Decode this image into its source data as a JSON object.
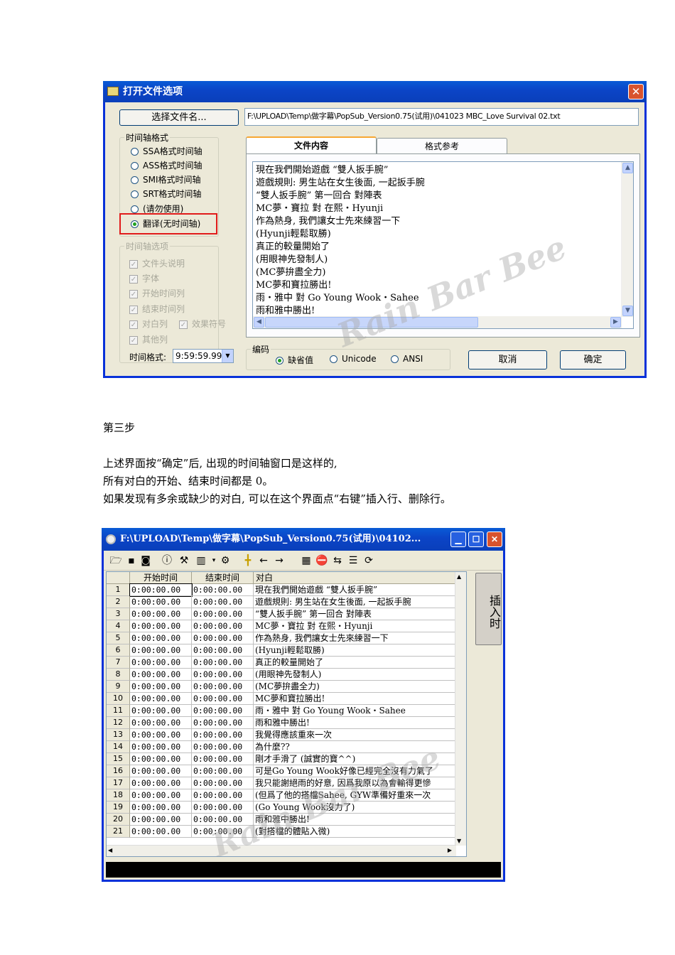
{
  "dialog1": {
    "title": "打开文件选项",
    "choose_file_button": "选择文件名...",
    "file_path": "F:\\UPLOAD\\Temp\\做字幕\\PopSub_Version0.75(试用)\\041023 MBC_Love Survival 02.txt",
    "timeline_format": {
      "group_title": "时间轴格式",
      "options": [
        "SSA格式时间轴",
        "ASS格式时间轴",
        "SMI格式时间轴",
        "SRT格式时间轴",
        "(请勿使用)",
        "翻译(无时间轴)"
      ],
      "selected_index": 5
    },
    "timeline_options": {
      "group_title": "时间轴选项",
      "items": [
        "文件头说明",
        "字体",
        "开始时间列",
        "结束时间列",
        "对白列",
        "效果符号",
        "其他列"
      ]
    },
    "time_format_label": "时间格式:",
    "time_format_value": "9:59:59.99",
    "tabs": [
      "文件内容",
      "格式参考"
    ],
    "content_lines": [
      "現在我們開始遊戲 “雙人扳手腕”",
      "遊戲規則: 男生站在女生後面, 一起扳手腕",
      "“雙人扳手腕” 第一回合 對陣表",
      "MC夢・寶拉 對 在熙・Hyunji",
      "作為熱身, 我們讓女士先來練習一下",
      "(Hyunji輕鬆取勝)",
      "真正的較量開始了",
      "(用眼神先發制人)",
      "(MC夢拚盡全力)",
      "MC夢和寶拉勝出!",
      "雨・雅中 對 Go Young Wook・Sahee",
      "雨和雅中勝出!"
    ],
    "encoding": {
      "group_title": "编码",
      "options": [
        "缺省值",
        "Unicode",
        "ANSI"
      ],
      "selected_index": 0
    },
    "cancel_button": "取消",
    "ok_button": "确定",
    "watermark": "Rain Bar Bee"
  },
  "paragraphs": {
    "step": "第三步",
    "line1": "上述界面按“确定”后, 出现的时间轴窗口是这样的,",
    "line2": "所有对白的开始、结束时间都是 0。",
    "line3": "如果发现有多余或缺少的对白, 可以在这个界面点“右键”插入行、删除行。"
  },
  "dialog2": {
    "title": "F:\\UPLOAD\\Temp\\做字幕\\PopSub_Version0.75(试用)\\04102...",
    "columns": [
      "开始时间",
      "结束时间",
      "对白"
    ],
    "rows": [
      {
        "n": "1",
        "start": "0:00:00.00",
        "end": "0:00:00.00",
        "text": "現在我們開始遊戲 “雙人扳手腕”"
      },
      {
        "n": "2",
        "start": "0:00:00.00",
        "end": "0:00:00.00",
        "text": "遊戲規則: 男生站在女生後面, 一起扳手腕"
      },
      {
        "n": "3",
        "start": "0:00:00.00",
        "end": "0:00:00.00",
        "text": "“雙人扳手腕” 第一回合 對陣表"
      },
      {
        "n": "4",
        "start": "0:00:00.00",
        "end": "0:00:00.00",
        "text": "MC夢・寶拉 對 在熙・Hyunji"
      },
      {
        "n": "5",
        "start": "0:00:00.00",
        "end": "0:00:00.00",
        "text": "作為熱身, 我們讓女士先來練習一下"
      },
      {
        "n": "6",
        "start": "0:00:00.00",
        "end": "0:00:00.00",
        "text": "(Hyunji輕鬆取勝)"
      },
      {
        "n": "7",
        "start": "0:00:00.00",
        "end": "0:00:00.00",
        "text": "真正的較量開始了"
      },
      {
        "n": "8",
        "start": "0:00:00.00",
        "end": "0:00:00.00",
        "text": "(用眼神先發制人)"
      },
      {
        "n": "9",
        "start": "0:00:00.00",
        "end": "0:00:00.00",
        "text": "(MC夢拚盡全力)"
      },
      {
        "n": "10",
        "start": "0:00:00.00",
        "end": "0:00:00.00",
        "text": "MC夢和寶拉勝出!"
      },
      {
        "n": "11",
        "start": "0:00:00.00",
        "end": "0:00:00.00",
        "text": "雨・雅中 對 Go Young Wook・Sahee"
      },
      {
        "n": "12",
        "start": "0:00:00.00",
        "end": "0:00:00.00",
        "text": "雨和雅中勝出!"
      },
      {
        "n": "13",
        "start": "0:00:00.00",
        "end": "0:00:00.00",
        "text": "我覺得應該重來一次"
      },
      {
        "n": "14",
        "start": "0:00:00.00",
        "end": "0:00:00.00",
        "text": "為什麼??"
      },
      {
        "n": "15",
        "start": "0:00:00.00",
        "end": "0:00:00.00",
        "text": "剛才手滑了 (誠實的寶^^)"
      },
      {
        "n": "16",
        "start": "0:00:00.00",
        "end": "0:00:00.00",
        "text": "可是Go Young Wook好像已經完全沒有力氣了"
      },
      {
        "n": "17",
        "start": "0:00:00.00",
        "end": "0:00:00.00",
        "text": "我只能謝絕雨的好意, 因爲我原以為會輸得更慘"
      },
      {
        "n": "18",
        "start": "0:00:00.00",
        "end": "0:00:00.00",
        "text": "(但爲了他的搭檔Sahee, GYW準備好重來一次"
      },
      {
        "n": "19",
        "start": "0:00:00.00",
        "end": "0:00:00.00",
        "text": "(Go Young Wook沒力了)"
      },
      {
        "n": "20",
        "start": "0:00:00.00",
        "end": "0:00:00.00",
        "text": "雨和雅中勝出!"
      },
      {
        "n": "21",
        "start": "0:00:00.00",
        "end": "0:00:00.00",
        "text": "(對搭檔的體貼入微)"
      }
    ],
    "insert_button": "插入时",
    "watermark": "Rain Bar Bee"
  }
}
